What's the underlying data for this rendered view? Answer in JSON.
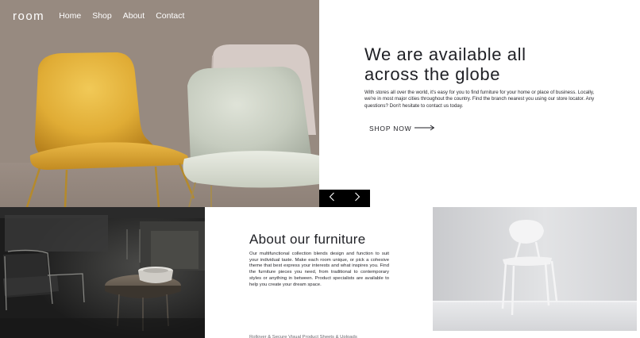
{
  "nav": {
    "logo": "room",
    "links": [
      "Home",
      "Shop",
      "About",
      "Contact"
    ]
  },
  "hero": {
    "title_line1": "We are available all",
    "title_line2": "across the globe",
    "description": "With stores all over the world, it's easy for you to find furniture for your home or place of business. Locally, we're in most major cities throughout the country. Find the branch nearest you using our store locator. Any questions? Don't hesitate to contact us today.",
    "cta_label": "SHOP NOW",
    "cta_icon": "arrow-right-icon"
  },
  "slider": {
    "prev_icon": "chevron-left-icon",
    "next_icon": "chevron-right-icon"
  },
  "about": {
    "title": "About our furniture",
    "body": "Our multifunctional collection blends design and function to suit your individual taste. Make each room unique, or pick a cohesive theme that best express your interests and what inspires you. Find the furniture pieces you need, from traditional to contemporary styles or anything in between. Product specialists are available to help you create your dream space.",
    "next_paragraph_partial": "Rollover & Secure Visual Product Sheets & Uploads"
  },
  "colors": {
    "text": "#1f2025",
    "slider_bg": "#000000",
    "white": "#ffffff",
    "chair_yellow": "#e3b23c",
    "chair_sage": "#c9cec2",
    "chair_pink": "#d8ccc6"
  }
}
